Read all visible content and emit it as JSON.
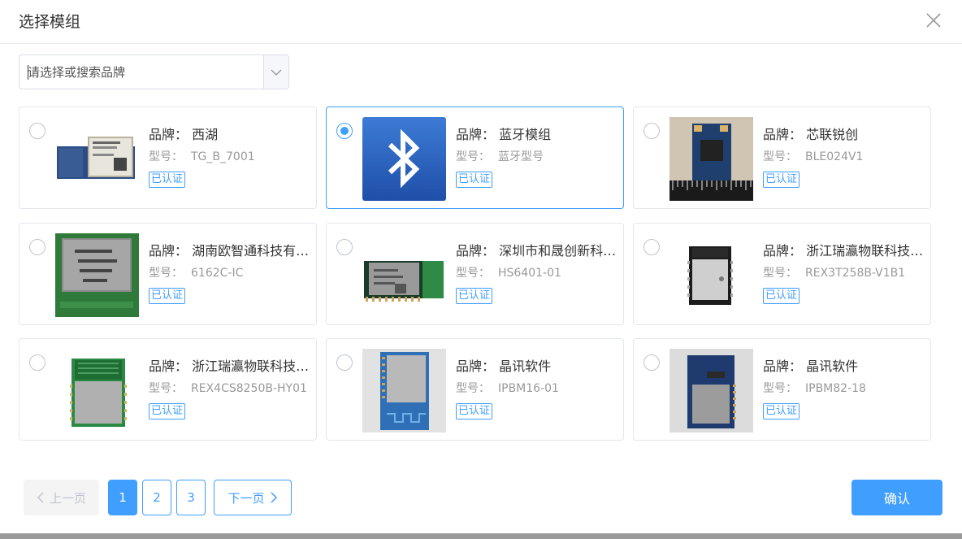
{
  "dialog": {
    "title": "选择模组",
    "close_icon": "close-icon"
  },
  "brand_select": {
    "placeholder": "请选择或搜索品牌",
    "value": "",
    "arrow_icon": "chevron-down-icon"
  },
  "labels": {
    "brand": "品牌：",
    "model": "型号：",
    "certified": "已认证"
  },
  "modules": [
    {
      "brand": "西湖",
      "model": "TG_B_7001",
      "certified": "已认证",
      "selected": false,
      "image": "module-photo"
    },
    {
      "brand": "蓝牙模组",
      "model": "蓝牙型号",
      "certified": "已认证",
      "selected": true,
      "image": "bluetooth-icon"
    },
    {
      "brand": "芯联锐创",
      "model": "BLE024V1",
      "certified": "已认证",
      "selected": false,
      "image": "module-photo"
    },
    {
      "brand": "湖南欧智通科技有限公司",
      "model": "6162C-IC",
      "certified": "已认证",
      "selected": false,
      "image": "module-photo"
    },
    {
      "brand": "深圳市和晟创新科技有限公司",
      "model": "HS6401-01",
      "certified": "已认证",
      "selected": false,
      "image": "module-photo"
    },
    {
      "brand": "浙江瑞瀛物联科技有限公司",
      "model": "REX3T258B-V1B1",
      "certified": "已认证",
      "selected": false,
      "image": "module-photo"
    },
    {
      "brand": "浙江瑞瀛物联科技有限公司",
      "model": "REX4CS8250B-HY01",
      "certified": "已认证",
      "selected": false,
      "image": "module-photo"
    },
    {
      "brand": "晶讯软件",
      "model": "IPBM16-01",
      "certified": "已认证",
      "selected": false,
      "image": "module-photo"
    },
    {
      "brand": "晶讯软件",
      "model": "IPBM82-18",
      "certified": "已认证",
      "selected": false,
      "image": "module-photo"
    }
  ],
  "pagination": {
    "prev": "上一页",
    "next": "下一页",
    "pages": [
      "1",
      "2",
      "3"
    ],
    "current": "1"
  },
  "confirm_label": "确认",
  "colors": {
    "accent": "#409eff",
    "border": "#e4e7ed"
  }
}
